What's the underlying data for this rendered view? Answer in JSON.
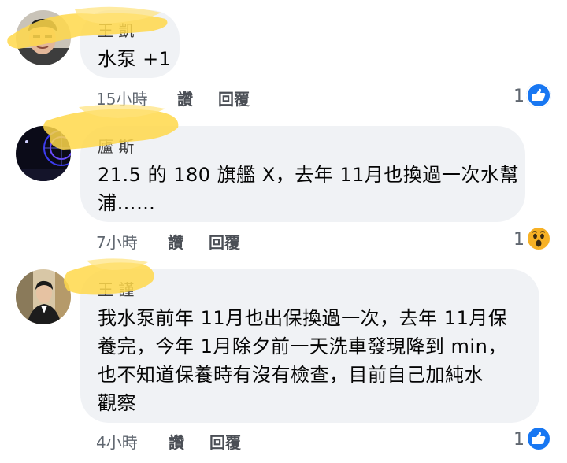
{
  "comments": [
    {
      "name": "王 凱",
      "text_lines": [
        "水泵 +1"
      ],
      "time": "15小時",
      "like_label": "讚",
      "reply_label": "回覆",
      "reaction_count": "1",
      "reaction_icon": "like-icon",
      "reaction_color": "#1877f2"
    },
    {
      "name": "廬 斯",
      "text_lines": [
        "21.5 的 180 旗艦 X，去年 11月也換過一次水幫",
        "浦……"
      ],
      "time": "7小時",
      "like_label": "讚",
      "reply_label": "回覆",
      "reaction_count": "1",
      "reaction_icon": "wow-icon",
      "reaction_color": "#f7b125"
    },
    {
      "name": "王 謹",
      "text_lines": [
        "我水泵前年 11月也出保換過一次，去年 11月保",
        "養完，今年 1月除夕前一天洗車發現降到 min，",
        "也不知道保養時有沒有檢查，目前自己加純水",
        "觀察"
      ],
      "time": "4小時",
      "like_label": "讚",
      "reply_label": "回覆",
      "reaction_count": "1",
      "reaction_icon": "like-icon",
      "reaction_color": "#1877f2"
    }
  ],
  "colors": {
    "bubble": "#f0f2f5",
    "redaction": "#ffd84a",
    "meta_text": "#606770"
  }
}
